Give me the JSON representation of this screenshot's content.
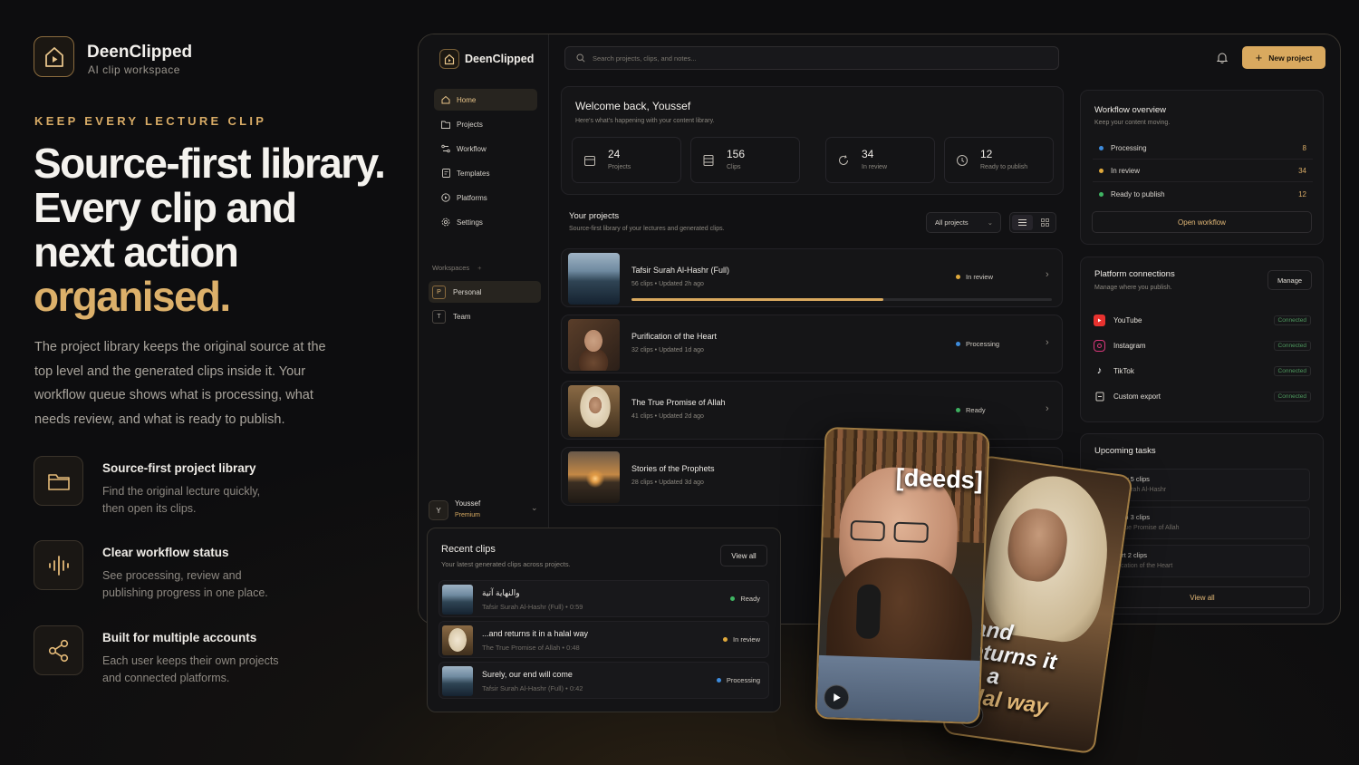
{
  "brand": {
    "name": "DeenClipped",
    "tagline": "AI clip workspace"
  },
  "hero": {
    "eyebrow": "KEEP EVERY LECTURE CLIP",
    "headline_lines": [
      "Source-first library.",
      "Every clip and",
      "next action"
    ],
    "headline_accent": "organised.",
    "description": "The project library keeps the original source at the top level and the generated clips inside it. Your workflow queue shows what is processing, what needs review, and what is ready to publish."
  },
  "features": [
    {
      "icon": "folder-icon",
      "title": "Source-first project library",
      "desc": "Find the original lecture quickly, then open its clips."
    },
    {
      "icon": "waveform-icon",
      "title": "Clear workflow status",
      "desc": "See processing, review and publishing progress in one place."
    },
    {
      "icon": "share-icon",
      "title": "Built for multiple accounts",
      "desc": "Each user keeps their own projects and connected platforms."
    }
  ],
  "app": {
    "brand": "DeenClipped",
    "search_placeholder": "Search projects, clips, and notes...",
    "new_project": "New project",
    "nav": [
      {
        "label": "Home",
        "icon": "home-icon",
        "active": true
      },
      {
        "label": "Projects",
        "icon": "folder-icon"
      },
      {
        "label": "Workflow",
        "icon": "workflow-icon"
      },
      {
        "label": "Templates",
        "icon": "template-icon"
      },
      {
        "label": "Platforms",
        "icon": "platform-icon"
      },
      {
        "label": "Settings",
        "icon": "gear-icon"
      }
    ],
    "workspaces_label": "Workspaces",
    "workspaces": [
      {
        "initial": "P",
        "label": "Personal",
        "active": true
      },
      {
        "initial": "T",
        "label": "Team"
      }
    ],
    "user": {
      "initial": "Y",
      "name": "Youssef",
      "plan": "Premium"
    },
    "welcome": {
      "title": "Welcome back, Youssef",
      "subtitle": "Here's what's happening with your content library."
    },
    "stats": [
      {
        "icon": "calendar-icon",
        "value": "24",
        "label": "Projects"
      },
      {
        "icon": "film-icon",
        "value": "156",
        "label": "Clips"
      },
      {
        "icon": "refresh-icon",
        "value": "34",
        "label": "In review"
      },
      {
        "icon": "clock-icon",
        "value": "12",
        "label": "Ready to publish"
      }
    ],
    "projects_header": {
      "title": "Your projects",
      "subtitle": "Source-first library of your lectures and generated clips.",
      "filter": "All projects"
    },
    "projects": [
      {
        "name": "Tafsir Surah Al-Hashr (Full)",
        "clips": "56 clips",
        "updated": "Updated 2h ago",
        "status": "In review",
        "status_color": "#e0a93c",
        "progress": 0.6,
        "thumb": "lake"
      },
      {
        "name": "Purification of the Heart",
        "clips": "32 clips",
        "updated": "Updated 1d ago",
        "status": "Processing",
        "status_color": "#3d8bdc",
        "thumb": "man"
      },
      {
        "name": "The True Promise of Allah",
        "clips": "41 clips",
        "updated": "Updated 2d ago",
        "status": "Ready",
        "status_color": "#3fb563",
        "thumb": "sheikh"
      },
      {
        "name": "Stories of the Prophets",
        "clips": "28 clips",
        "updated": "Updated 3d ago",
        "status": "",
        "status_color": "",
        "thumb": "sunset"
      }
    ],
    "workflow": {
      "title": "Workflow overview",
      "subtitle": "Keep your content moving.",
      "rows": [
        {
          "label": "Processing",
          "count": "8",
          "color": "#3d8bdc"
        },
        {
          "label": "In review",
          "count": "34",
          "color": "#e0a93c"
        },
        {
          "label": "Ready to publish",
          "count": "12",
          "color": "#3fb563"
        }
      ],
      "button": "Open workflow"
    },
    "platforms": {
      "title": "Platform connections",
      "subtitle": "Manage where you publish.",
      "manage": "Manage",
      "items": [
        {
          "name": "YouTube",
          "status": "Connected",
          "icon": "youtube-icon",
          "color": "#e8322f"
        },
        {
          "name": "Instagram",
          "status": "Connected",
          "icon": "instagram-icon",
          "color": "#d8377a"
        },
        {
          "name": "TikTok",
          "status": "Connected",
          "icon": "tiktok-icon",
          "color": "#ffffff"
        },
        {
          "name": "Custom export",
          "status": "Connected",
          "icon": "export-icon",
          "color": "#cfcac2"
        }
      ]
    },
    "tasks": {
      "title": "Upcoming tasks",
      "items": [
        {
          "title": "Review 5 clips",
          "sub": "Tafsir Surah Al-Hashr"
        },
        {
          "title": "Publish 3 clips",
          "sub": "The True Promise of Allah"
        },
        {
          "title": "Export 2 clips",
          "sub": "Purification of the Heart"
        }
      ],
      "view_all": "View all"
    },
    "recent": {
      "title": "Recent clips",
      "subtitle": "Your latest generated clips across projects.",
      "view_all": "View all",
      "items": [
        {
          "title": "والنهاية آتية",
          "project": "Tafsir Surah Al-Hashr (Full)",
          "dur": "0:59",
          "status": "Ready",
          "color": "#3fb563",
          "thumb": "lake"
        },
        {
          "title": "...and returns it in a halal way",
          "project": "The True Promise of Allah",
          "dur": "0:48",
          "status": "In review",
          "color": "#e0a93c",
          "thumb": "sheikh"
        },
        {
          "title": "Surely, our end will come",
          "project": "Tafsir Surah Al-Hashr (Full)",
          "dur": "0:42",
          "status": "Processing",
          "color": "#3d8bdc",
          "thumb": "lake"
        }
      ]
    }
  },
  "phones": {
    "caption1": "[deeds]",
    "caption2_lines": [
      "and",
      "eturns it",
      "n a",
      "alal way"
    ]
  }
}
